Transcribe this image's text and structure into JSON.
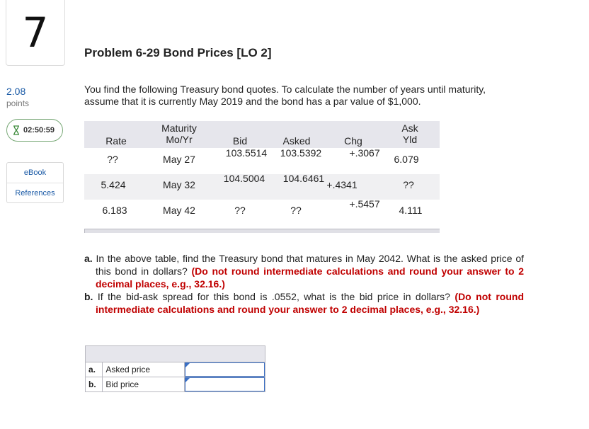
{
  "question": {
    "number": "7",
    "points_value": "2.08",
    "points_label": "points",
    "timer": "02:50:59"
  },
  "sidebar": {
    "links": [
      "eBook",
      "References"
    ]
  },
  "problem": {
    "title": "Problem 6-29 Bond Prices [LO 2]",
    "intro": "You find the following Treasury bond quotes. To calculate the number of years until maturity, assume that it is currently May 2019 and the bond has a par value of $1,000."
  },
  "bond_table": {
    "headers": {
      "rate": "Rate",
      "maturity_top": "Maturity",
      "maturity_bottom": "Mo/Yr",
      "bid": "Bid",
      "asked": "Asked",
      "chg": "Chg",
      "ask_top": "Ask",
      "ask_bottom": "Yld"
    },
    "rows": [
      {
        "rate": "??",
        "maturity": "May 27",
        "bid": "103.5514",
        "asked": "103.5392",
        "chg": "+.3067",
        "yld": "6.079"
      },
      {
        "rate": "5.424",
        "maturity": "May 32",
        "bid": "104.5004",
        "asked": "104.6461",
        "chg": "+.4341",
        "yld": "??"
      },
      {
        "rate": "6.183",
        "maturity": "May 42",
        "bid": "??",
        "asked": "??",
        "chg": "+.5457",
        "yld": "4.111"
      }
    ]
  },
  "questions": {
    "a_label": "a.",
    "a_text": "In the above table, find the Treasury bond that matures in May 2042. What is the asked price of this bond in dollars?",
    "a_note": "(Do not round intermediate calculations and round your answer to 2 decimal places, e.g., 32.16.)",
    "b_label": "b.",
    "b_text": "If the bid-ask spread for this bond is .0552, what is the bid price in dollars?",
    "b_note": "(Do not round intermediate calculations and round your answer to 2 decimal places, e.g., 32.16.)"
  },
  "answer_table": {
    "rows": [
      {
        "letter": "a.",
        "label": "Asked price",
        "value": ""
      },
      {
        "letter": "b.",
        "label": "Bid price",
        "value": ""
      }
    ]
  }
}
